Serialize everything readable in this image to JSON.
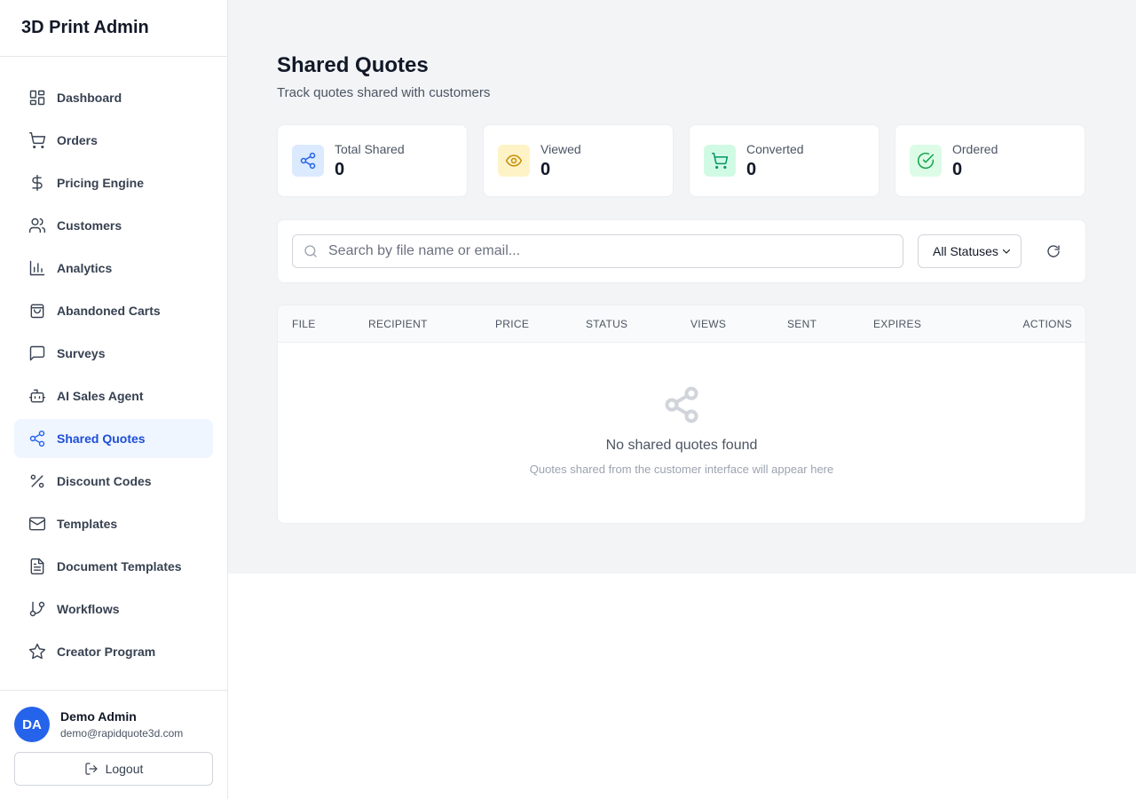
{
  "app": {
    "title": "3D Print Admin"
  },
  "sidebar": {
    "items": [
      {
        "label": "Dashboard",
        "icon": "dashboard-icon"
      },
      {
        "label": "Orders",
        "icon": "cart-icon"
      },
      {
        "label": "Pricing Engine",
        "icon": "dollar-icon"
      },
      {
        "label": "Customers",
        "icon": "users-icon"
      },
      {
        "label": "Analytics",
        "icon": "bar-chart-icon"
      },
      {
        "label": "Abandoned Carts",
        "icon": "shopping-bag-icon"
      },
      {
        "label": "Surveys",
        "icon": "message-square-icon"
      },
      {
        "label": "AI Sales Agent",
        "icon": "bot-icon"
      },
      {
        "label": "Shared Quotes",
        "icon": "share-icon",
        "active": true
      },
      {
        "label": "Discount Codes",
        "icon": "percent-icon"
      },
      {
        "label": "Templates",
        "icon": "mail-icon"
      },
      {
        "label": "Document Templates",
        "icon": "file-text-icon"
      },
      {
        "label": "Workflows",
        "icon": "git-branch-icon"
      },
      {
        "label": "Creator Program",
        "icon": "star-icon"
      }
    ]
  },
  "user": {
    "initials": "DA",
    "name": "Demo Admin",
    "email": "demo@rapidquote3d.com",
    "logout_label": "Logout"
  },
  "page": {
    "title": "Shared Quotes",
    "subtitle": "Track quotes shared with customers"
  },
  "stats": [
    {
      "label": "Total Shared",
      "value": "0",
      "icon": "share-icon",
      "bg": "#dbeafe",
      "color": "#2563eb"
    },
    {
      "label": "Viewed",
      "value": "0",
      "icon": "eye-icon",
      "bg": "#fef3c7",
      "color": "#ca8a04"
    },
    {
      "label": "Converted",
      "value": "0",
      "icon": "cart-icon",
      "bg": "#d1fae5",
      "color": "#059669"
    },
    {
      "label": "Ordered",
      "value": "0",
      "icon": "check-circle-icon",
      "bg": "#dcfce7",
      "color": "#16a34a"
    }
  ],
  "filters": {
    "search_placeholder": "Search by file name or email...",
    "status_selected": "All Statuses"
  },
  "table": {
    "columns": [
      "FILE",
      "RECIPIENT",
      "PRICE",
      "STATUS",
      "VIEWS",
      "SENT",
      "EXPIRES",
      "ACTIONS"
    ],
    "empty_title": "No shared quotes found",
    "empty_subtitle": "Quotes shared from the customer interface will appear here"
  },
  "colors": {
    "accent": "#2563eb",
    "active_nav_bg": "#eff6ff",
    "page_bg": "#f3f4f6"
  }
}
